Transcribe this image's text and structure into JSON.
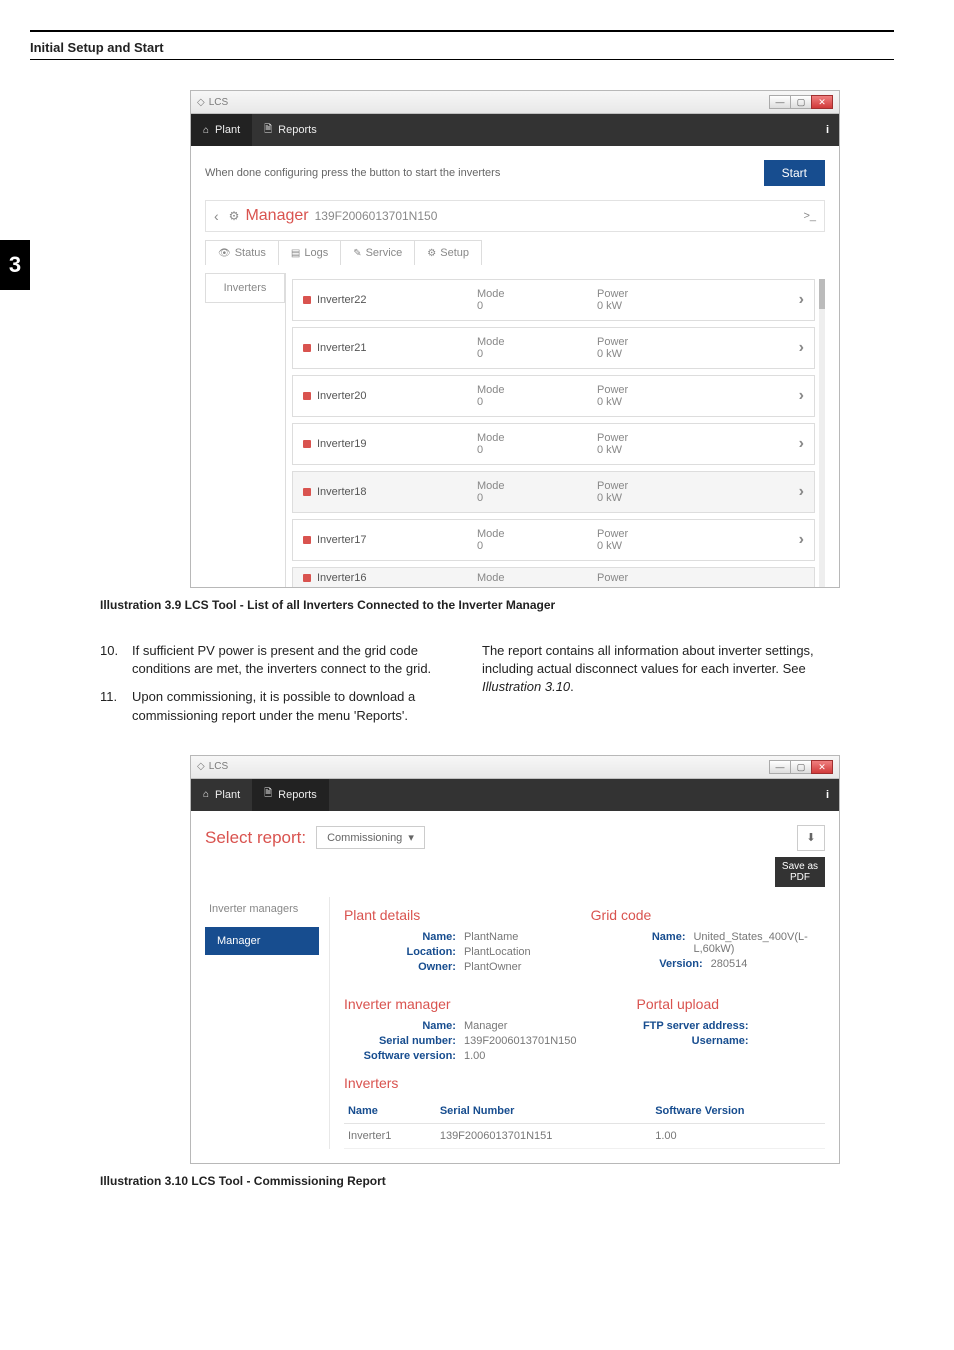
{
  "section_title": "Initial Setup and Start",
  "chapter_number": "3",
  "win1": {
    "app_title": "LCS",
    "nav": {
      "plant": "Plant",
      "reports": "Reports",
      "info": "i"
    },
    "config_msg": "When done configuring press the button to start the inverters",
    "start_label": "Start",
    "manager_name": "Manager",
    "manager_serial": "139F2006013701N150",
    "cmd_prompt": ">_",
    "subtabs": {
      "status": "Status",
      "logs": "Logs",
      "service": "Service",
      "setup": "Setup"
    },
    "side_tab": "Inverters",
    "cols": {
      "mode": "Mode",
      "power": "Power"
    },
    "items": [
      {
        "name": "Inverter22",
        "mode": "0",
        "power": "0 kW",
        "alt": false
      },
      {
        "name": "Inverter21",
        "mode": "0",
        "power": "0 kW",
        "alt": false
      },
      {
        "name": "Inverter20",
        "mode": "0",
        "power": "0 kW",
        "alt": false
      },
      {
        "name": "Inverter19",
        "mode": "0",
        "power": "0 kW",
        "alt": false
      },
      {
        "name": "Inverter18",
        "mode": "0",
        "power": "0 kW",
        "alt": true
      },
      {
        "name": "Inverter17",
        "mode": "0",
        "power": "0 kW",
        "alt": false
      },
      {
        "name": "Inverter16",
        "mode": "",
        "power": "",
        "alt": true,
        "cut": true
      }
    ]
  },
  "caption1_a": "Illustration 3.9 LCS Tool - List of all Inverters Connected to the Inverter Manager",
  "steps": {
    "s10n": "10.",
    "s10": "If sufficient PV power is present and the grid code conditions are met, the inverters connect to the grid.",
    "s11n": "11.",
    "s11": "Upon commissioning, it is possible to download a commissioning report under the menu 'Reports'.",
    "right_a": "The report contains all information about inverter settings, including actual disconnect values for each inverter. See ",
    "right_b": "Illustration 3.10",
    "right_c": "."
  },
  "win2": {
    "app_title": "LCS",
    "nav": {
      "plant": "Plant",
      "reports": "Reports",
      "info": "i"
    },
    "select_label": "Select report:",
    "select_value": "Commissioning",
    "save_pdf1": "Save as",
    "save_pdf2": "PDF",
    "side_title": "Inverter managers",
    "side_item": "Manager",
    "plant": {
      "title": "Plant details",
      "kv": [
        {
          "k": "Name:",
          "v": "PlantName"
        },
        {
          "k": "Location:",
          "v": "PlantLocation"
        },
        {
          "k": "Owner:",
          "v": "PlantOwner"
        }
      ]
    },
    "grid": {
      "title": "Grid code",
      "kv": [
        {
          "k": "Name:",
          "v": "United_States_400V(L-L,60kW)"
        },
        {
          "k": "Version:",
          "v": "280514"
        }
      ]
    },
    "im": {
      "title": "Inverter manager",
      "kv": [
        {
          "k": "Name:",
          "v": "Manager"
        },
        {
          "k": "Serial number:",
          "v": "139F2006013701N150"
        },
        {
          "k": "Software version:",
          "v": "1.00"
        }
      ]
    },
    "portal": {
      "title": "Portal upload",
      "kv": [
        {
          "k": "FTP server address:",
          "v": ""
        },
        {
          "k": "Username:",
          "v": ""
        }
      ]
    },
    "inverters": {
      "title": "Inverters",
      "headers": {
        "name": "Name",
        "serial": "Serial Number",
        "sw": "Software Version"
      },
      "rows": [
        {
          "name": "Inverter1",
          "serial": "139F2006013701N151",
          "sw": "1.00"
        }
      ]
    }
  },
  "caption2_a": "Illustration 3.10 LCS Tool - Commissioning Report"
}
